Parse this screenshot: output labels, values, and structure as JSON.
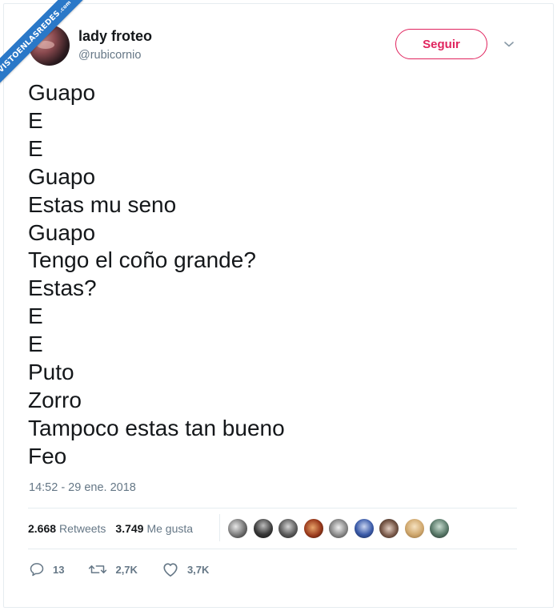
{
  "watermark": {
    "text": "VISTOENLASREDES",
    "suffix": ".com"
  },
  "header": {
    "display_name": "lady froteo",
    "handle": "@rubicornio",
    "follow_label": "Seguir"
  },
  "tweet": {
    "lines": [
      "Guapo",
      "E",
      "E",
      "Guapo",
      "Estas mu seno",
      "Guapo",
      "Tengo el coño grande?",
      "Estas?",
      "E",
      "E",
      "Puto",
      "Zorro",
      "Tampoco estas tan bueno",
      "Feo"
    ],
    "timestamp": "14:52 - 29 ene. 2018"
  },
  "stats": {
    "retweets_count": "2.668",
    "retweets_label": "Retweets",
    "likes_count": "3.749",
    "likes_label": "Me gusta"
  },
  "actions": {
    "reply_count": "13",
    "retweet_count": "2,7K",
    "like_count": "3,7K"
  },
  "colors": {
    "accent": "#e0245e",
    "secondary_text": "#657786",
    "ribbon": "#2a78c8"
  }
}
